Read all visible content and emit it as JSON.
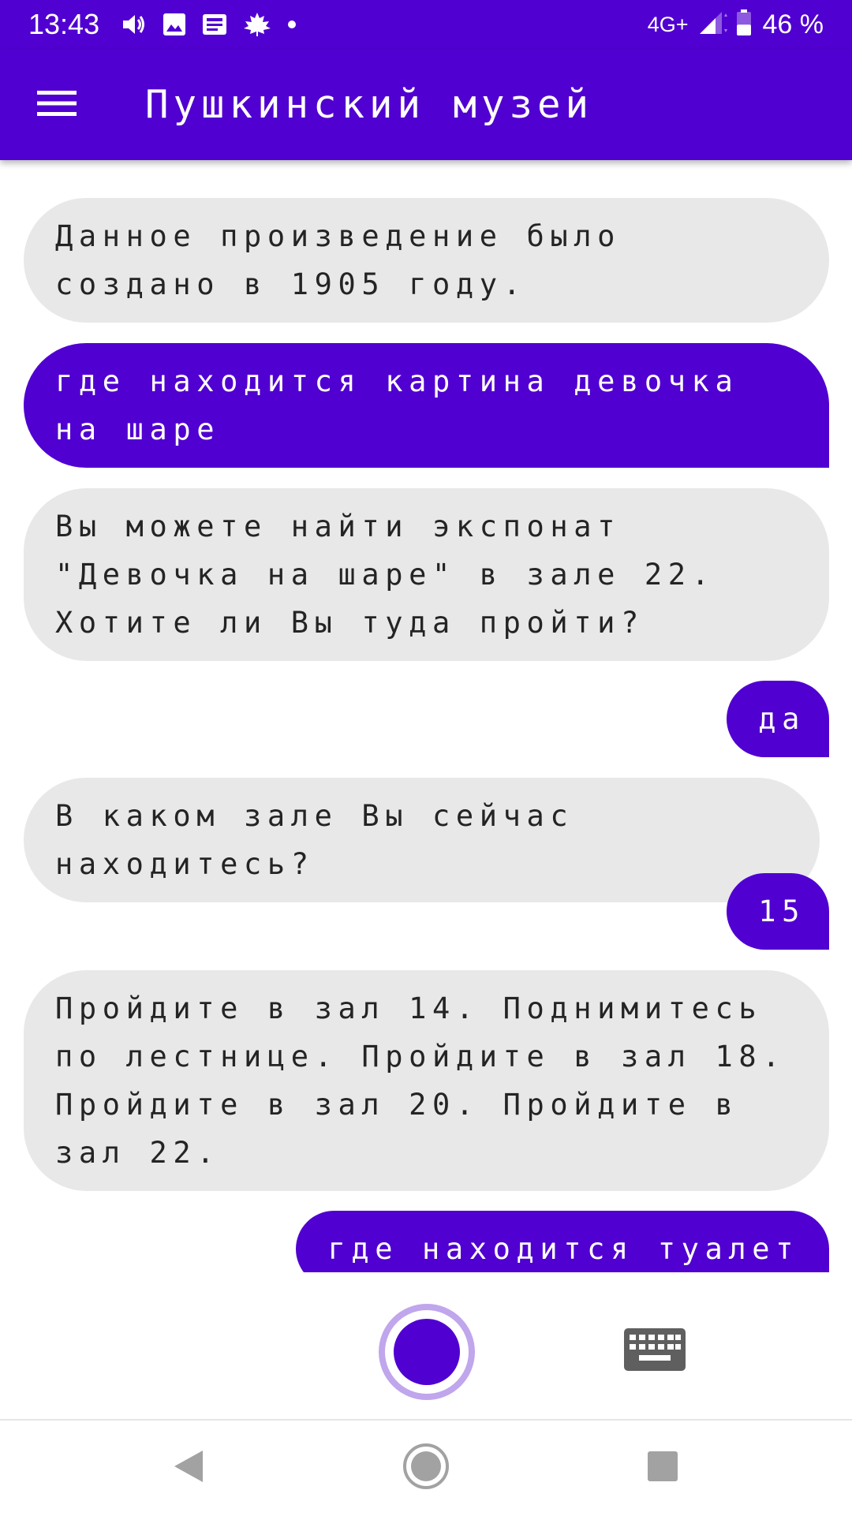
{
  "status_bar": {
    "time": "13:43",
    "notification_icons": [
      "volume-icon",
      "image-icon",
      "news-icon",
      "maple-leaf-icon",
      "dot-icon"
    ],
    "network_type": "4G+",
    "battery_percent": "46 %",
    "battery_level": 0.46
  },
  "app_bar": {
    "title": "Пушкинский музей",
    "menu_icon": "menu-icon"
  },
  "theme": {
    "primary": "#5000d0",
    "bot_bubble": "#e8e8e8",
    "bot_text": "#242424",
    "mic_ring": "#c0a6ec",
    "icon_gray": "#5f5f5f"
  },
  "messages": [
    {
      "from": "bot",
      "text": "Данное произведение было создано в 1905 году."
    },
    {
      "from": "user",
      "text": "где находится картина девочка на шаре"
    },
    {
      "from": "bot",
      "text": "Вы можете найти экспонат \"Девочка на шаре\" в зале 22. Хотите ли Вы туда пройти?"
    },
    {
      "from": "user",
      "text": "да"
    },
    {
      "from": "bot",
      "text": "В каком зале Вы сейчас находитесь?"
    },
    {
      "from": "user",
      "text": "15"
    },
    {
      "from": "bot",
      "text": "Пройдите в зал 14. Поднимитесь по лестнице. Пройдите в зал 18. Пройдите в зал 20. Пройдите в зал 22."
    },
    {
      "from": "user",
      "text": "где находится туалет"
    }
  ],
  "controls": {
    "mic_icon": "microphone-button",
    "keyboard_icon": "keyboard-icon"
  },
  "nav_bar": {
    "back_icon": "back-icon",
    "home_icon": "home-icon",
    "recents_icon": "recents-icon"
  }
}
